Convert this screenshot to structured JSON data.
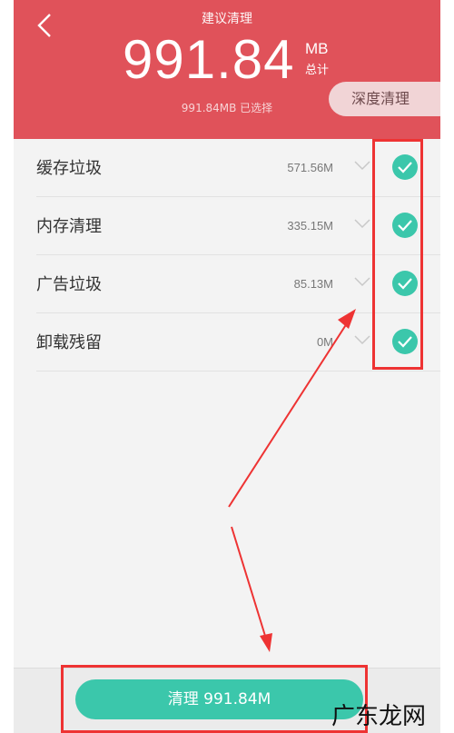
{
  "header": {
    "title": "建议清理",
    "total_size": "991.84",
    "unit": "MB",
    "total_label": "总计",
    "selected_text": "991.84MB 已选择",
    "deep_clean_label": "深度清理"
  },
  "items": [
    {
      "label": "缓存垃圾",
      "size": "571.56M"
    },
    {
      "label": "内存清理",
      "size": "335.15M"
    },
    {
      "label": "广告垃圾",
      "size": "85.13M"
    },
    {
      "label": "卸载残留",
      "size": "0M"
    }
  ],
  "footer": {
    "clean_button_label": "清理 991.84M"
  },
  "watermark": "广东龙网",
  "colors": {
    "header_bg": "#e0525a",
    "accent": "#3bc7ab",
    "annotation": "#ee3333"
  },
  "icons": {
    "back": "chevron-left-icon",
    "expand": "chevron-down-icon",
    "checked": "check-circle-icon"
  }
}
